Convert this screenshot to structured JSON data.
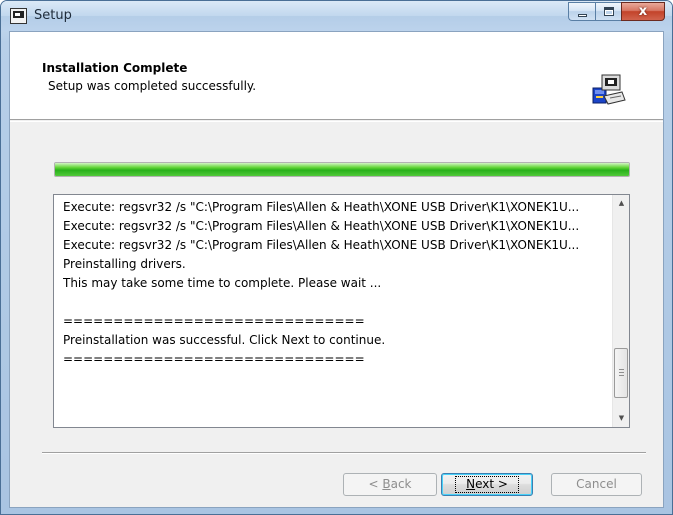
{
  "window": {
    "title": "Setup",
    "close_glyph": "x"
  },
  "header": {
    "title": "Installation Complete",
    "subtitle": "Setup was completed successfully."
  },
  "progress": {
    "percent": 100
  },
  "log": {
    "lines": [
      "Execute: regsvr32 /s \"C:\\Program Files\\Allen & Heath\\XONE USB Driver\\K1\\XONEK1U...",
      "Execute: regsvr32 /s \"C:\\Program Files\\Allen & Heath\\XONE USB Driver\\K1\\XONEK1U...",
      "Execute: regsvr32 /s \"C:\\Program Files\\Allen & Heath\\XONE USB Driver\\K1\\XONEK1U...",
      "Preinstalling drivers.",
      "This may take some time to complete. Please wait ...",
      "",
      "==============================",
      "Preinstallation was successful. Click Next to continue.",
      "=============================="
    ]
  },
  "buttons": {
    "back_prefix": "< ",
    "back_accel": "B",
    "back_rest": "ack",
    "next_accel": "N",
    "next_rest": "ext >",
    "cancel": "Cancel"
  },
  "icons": {
    "app": "setup-app-icon",
    "header": "installer-computer-icon"
  },
  "colors": {
    "progress_green": "#29b11a",
    "close_red": "#c2432a"
  }
}
